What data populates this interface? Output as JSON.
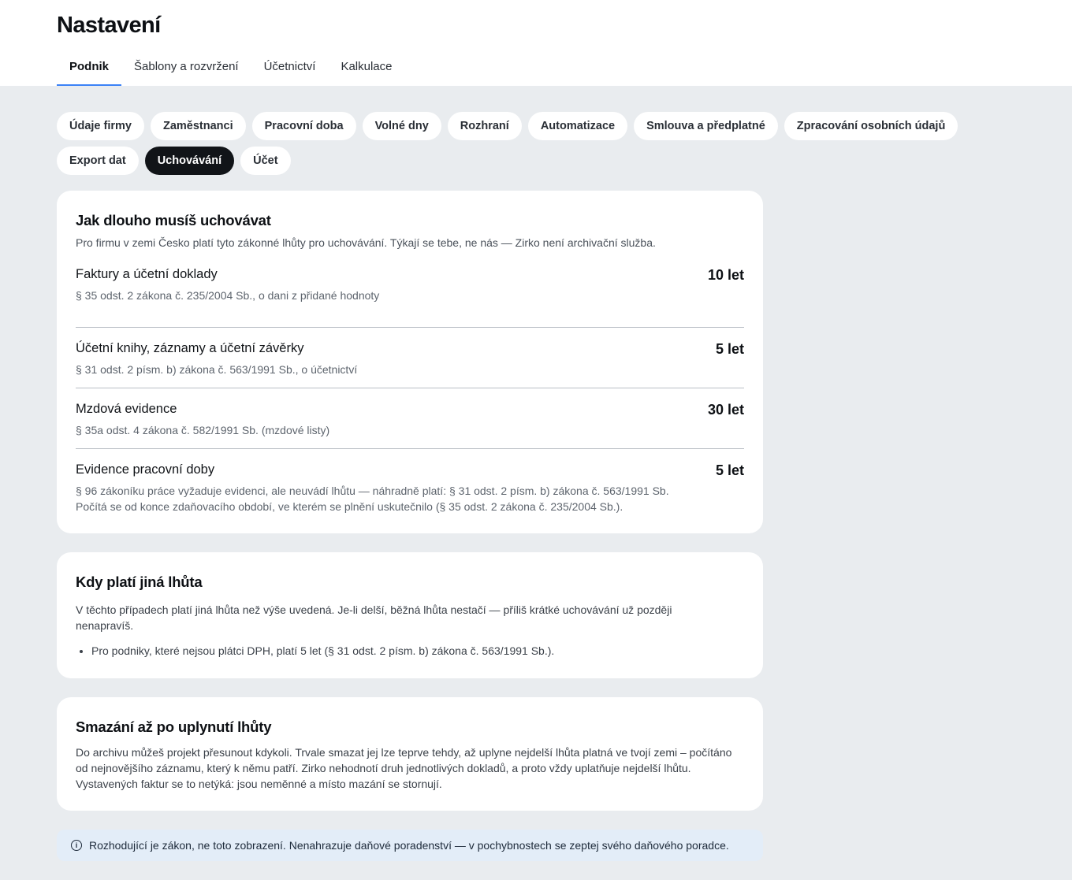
{
  "header": {
    "title": "Nastavení",
    "tabs": [
      "Podnik",
      "Šablony a rozvržení",
      "Účetnictví",
      "Kalkulace"
    ],
    "active_tab": "Podnik"
  },
  "subnav": {
    "chips": [
      "Údaje firmy",
      "Zaměstnanci",
      "Pracovní doba",
      "Volné dny",
      "Rozhraní",
      "Automatizace",
      "Smlouva a předplatné",
      "Zpracování osobních údajů",
      "Export dat",
      "Uchovávání",
      "Účet"
    ],
    "active_chip": "Uchovávání"
  },
  "retention": {
    "title": "Jak dlouho musíš uchovávat",
    "intro": "Pro firmu v zemi Česko platí tyto zákonné lhůty pro uchovávání. Týkají se tebe, ne nás — Zirko není archivační služba.",
    "items": [
      {
        "label": "Faktury a účetní doklady",
        "value": "10 let",
        "law": "§ 35 odst. 2 zákona č. 235/2004 Sb., o dani z přidané hodnoty"
      },
      {
        "label": "Účetní knihy, záznamy a účetní závěrky",
        "value": "5 let",
        "law": "§ 31 odst. 2 písm. b) zákona č. 563/1991 Sb., o účetnictví"
      },
      {
        "label": "Mzdová evidence",
        "value": "30 let",
        "law": "§ 35a odst. 4 zákona č. 582/1991 Sb. (mzdové listy)"
      },
      {
        "label": "Evidence pracovní doby",
        "value": "5 let",
        "law": "§ 96 zákoníku práce vyžaduje evidenci, ale neuvádí lhůtu — náhradně platí: § 31 odst. 2 písm. b) zákona č. 563/1991 Sb."
      }
    ],
    "footnote": "Počítá se od konce zdaňovacího období, ve kterém se plnění uskutečnilo (§ 35 odst. 2 zákona č. 235/2004 Sb.)."
  },
  "exceptions": {
    "title": "Kdy platí jiná lhůta",
    "text": "V těchto případech platí jiná lhůta než výše uvedená. Je-li delší, běžná lhůta nestačí — příliš krátké uchovávání už později nenapravíš.",
    "bullets": [
      "Pro podniky, které nejsou plátci DPH, platí 5 let (§ 31 odst. 2 písm. b) zákona č. 563/1991 Sb.)."
    ]
  },
  "deletion": {
    "title": "Smazání až po uplynutí lhůty",
    "text": "Do archivu můžeš projekt přesunout kdykoli. Trvale smazat jej lze teprve tehdy, až uplyne nejdelší lhůta platná ve tvojí zemi – počítáno od nejnovějšího záznamu, který k němu patří. Zirko nehodnotí druh jednotlivých dokladů, a proto vždy uplatňuje nejdelší lhůtu. Vystavených faktur se to netýká: jsou neměnné a místo mazání se stornují."
  },
  "notice": {
    "icon": "info-icon",
    "text": "Rozhodující je zákon, ne toto zobrazení. Nenahrazuje daňové poradenství — v pochybnostech se zeptej svého daňového poradce."
  }
}
